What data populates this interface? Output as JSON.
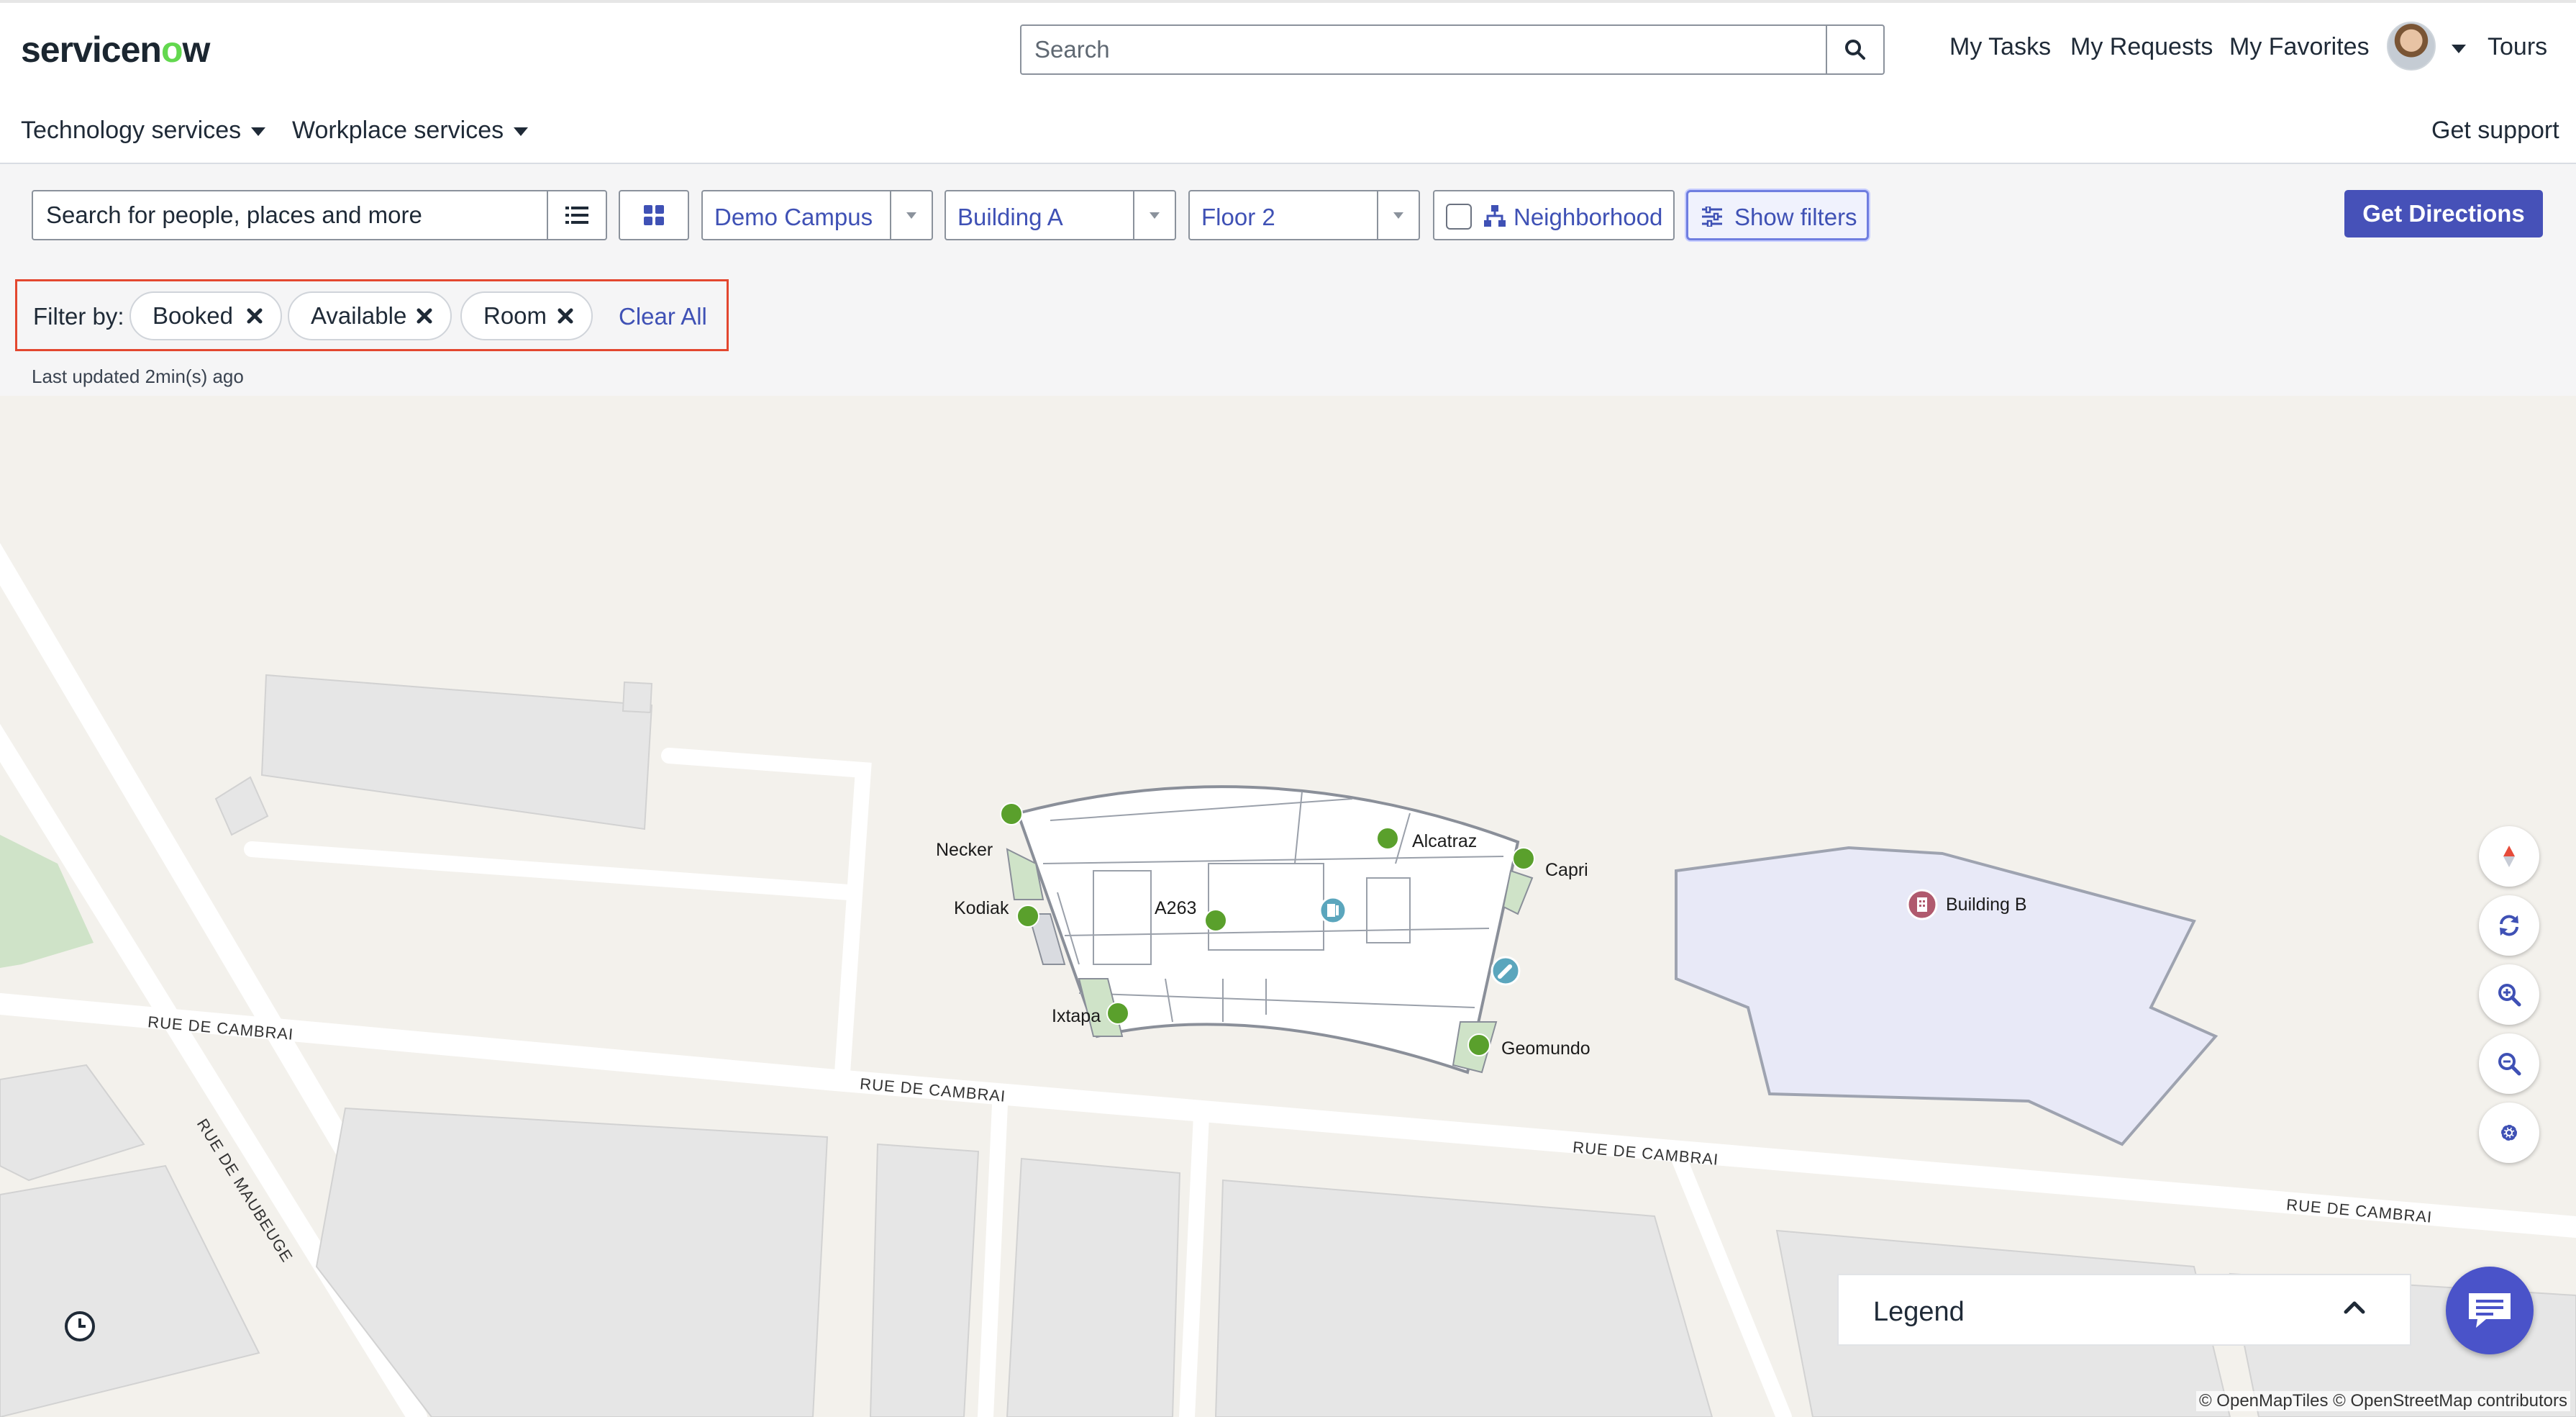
{
  "header": {
    "logo": {
      "text_before": "servicen",
      "text_accent": "o",
      "text_after": "w"
    },
    "search": {
      "placeholder": "Search"
    },
    "links": {
      "my_tasks": "My Tasks",
      "my_requests": "My Requests",
      "my_favorites": "My Favorites",
      "tours": "Tours"
    },
    "nav": [
      {
        "label": "Technology services"
      },
      {
        "label": "Workplace services"
      }
    ],
    "get_support": "Get support"
  },
  "toolbar": {
    "search_placeholder": "Search for people, places and more",
    "campus": "Demo Campus",
    "building": "Building A",
    "floor": "Floor 2",
    "neighborhood": "Neighborhood",
    "show_filters": "Show filters",
    "get_directions": "Get Directions"
  },
  "filters": {
    "label": "Filter by:",
    "chips": [
      {
        "label": "Booked"
      },
      {
        "label": "Available"
      },
      {
        "label": "Room"
      }
    ],
    "clear_all": "Clear All"
  },
  "last_updated": "Last updated 2min(s) ago",
  "map": {
    "rooms": [
      "Necker",
      "Alcatraz",
      "Capri",
      "Kodiak",
      "A263",
      "Ixtapa",
      "Geomundo"
    ],
    "building_b": "Building B",
    "streets": [
      "RUE DE CAMBRAI",
      "RUE DE CAMBRAI",
      "RUE DE CAMBRAI",
      "RUE DE CAMBRAI",
      "RUE DE MAUBEUGE"
    ],
    "legend": "Legend",
    "attribution": "© OpenMapTiles © OpenStreetMap contributors",
    "colors": {
      "available": "#5aa02c",
      "building_b_fill": "#e8e9f7",
      "accent": "#3f51b5"
    }
  }
}
